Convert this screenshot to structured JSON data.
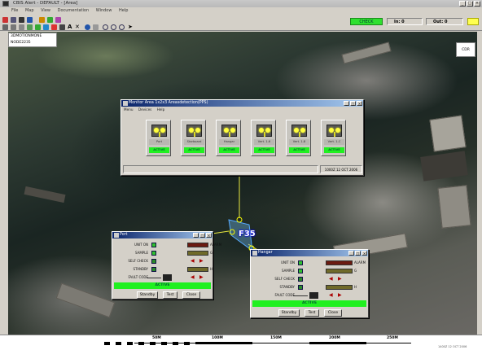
{
  "window": {
    "title": "CBIS Alert - DEFAULT - [Area]"
  },
  "menu": [
    "File",
    "Map",
    "View",
    "Documentation",
    "Window",
    "Help"
  ],
  "status": {
    "check_label": "CHECK",
    "in_label": "In: 0",
    "out_label": "Out: 0"
  },
  "layers": {
    "line1": "3DMOTIONMONE",
    "line2": "NODE2235"
  },
  "cdr_label": "CDR",
  "map_marker": "F35",
  "sensor_window": {
    "title": "Monitor Area 1x2x3 Areasdetection(PPS)",
    "menu": [
      "Menu",
      "Devices",
      "Help"
    ],
    "sensors": [
      {
        "name": "Port",
        "status": "ACTIVE"
      },
      {
        "name": "Starboard",
        "status": "ACTIVE"
      },
      {
        "name": "Hangar",
        "status": "ACTIVE"
      },
      {
        "name": "Vert. 1-6",
        "status": "ACTIVE"
      },
      {
        "name": "Vert. 1-8",
        "status": "ACTIVE"
      },
      {
        "name": "Vert. 1-C",
        "status": "ACTIVE"
      }
    ],
    "footer_time": "1000Z 12 OCT 2006"
  },
  "port_window": {
    "title": "Port",
    "rows": [
      "UNIT ON",
      "SAMPLE",
      "SELF CHECK",
      "STANDBY",
      "FAULT CODE"
    ],
    "alarm_label": "ALARM",
    "sample_suffix": "G",
    "standby_suffix": "H",
    "status": "ACTIVE",
    "buttons": [
      "Standby",
      "Test",
      "Close"
    ]
  },
  "hangar_window": {
    "title": "Hangar",
    "rows": [
      "UNIT ON",
      "SAMPLE",
      "SELF CHECK",
      "STANDBY",
      "FAULT CODE"
    ],
    "alarm_label": "ALARM",
    "sample_suffix": "G",
    "standby_suffix": "H",
    "status": "ACTIVE",
    "buttons": [
      "Standby",
      "Test",
      "Close"
    ]
  },
  "scale": {
    "labels": [
      "50M",
      "100M",
      "150M",
      "200M",
      "250M"
    ],
    "footer_right": "1400Z 12 OCT 2006"
  }
}
